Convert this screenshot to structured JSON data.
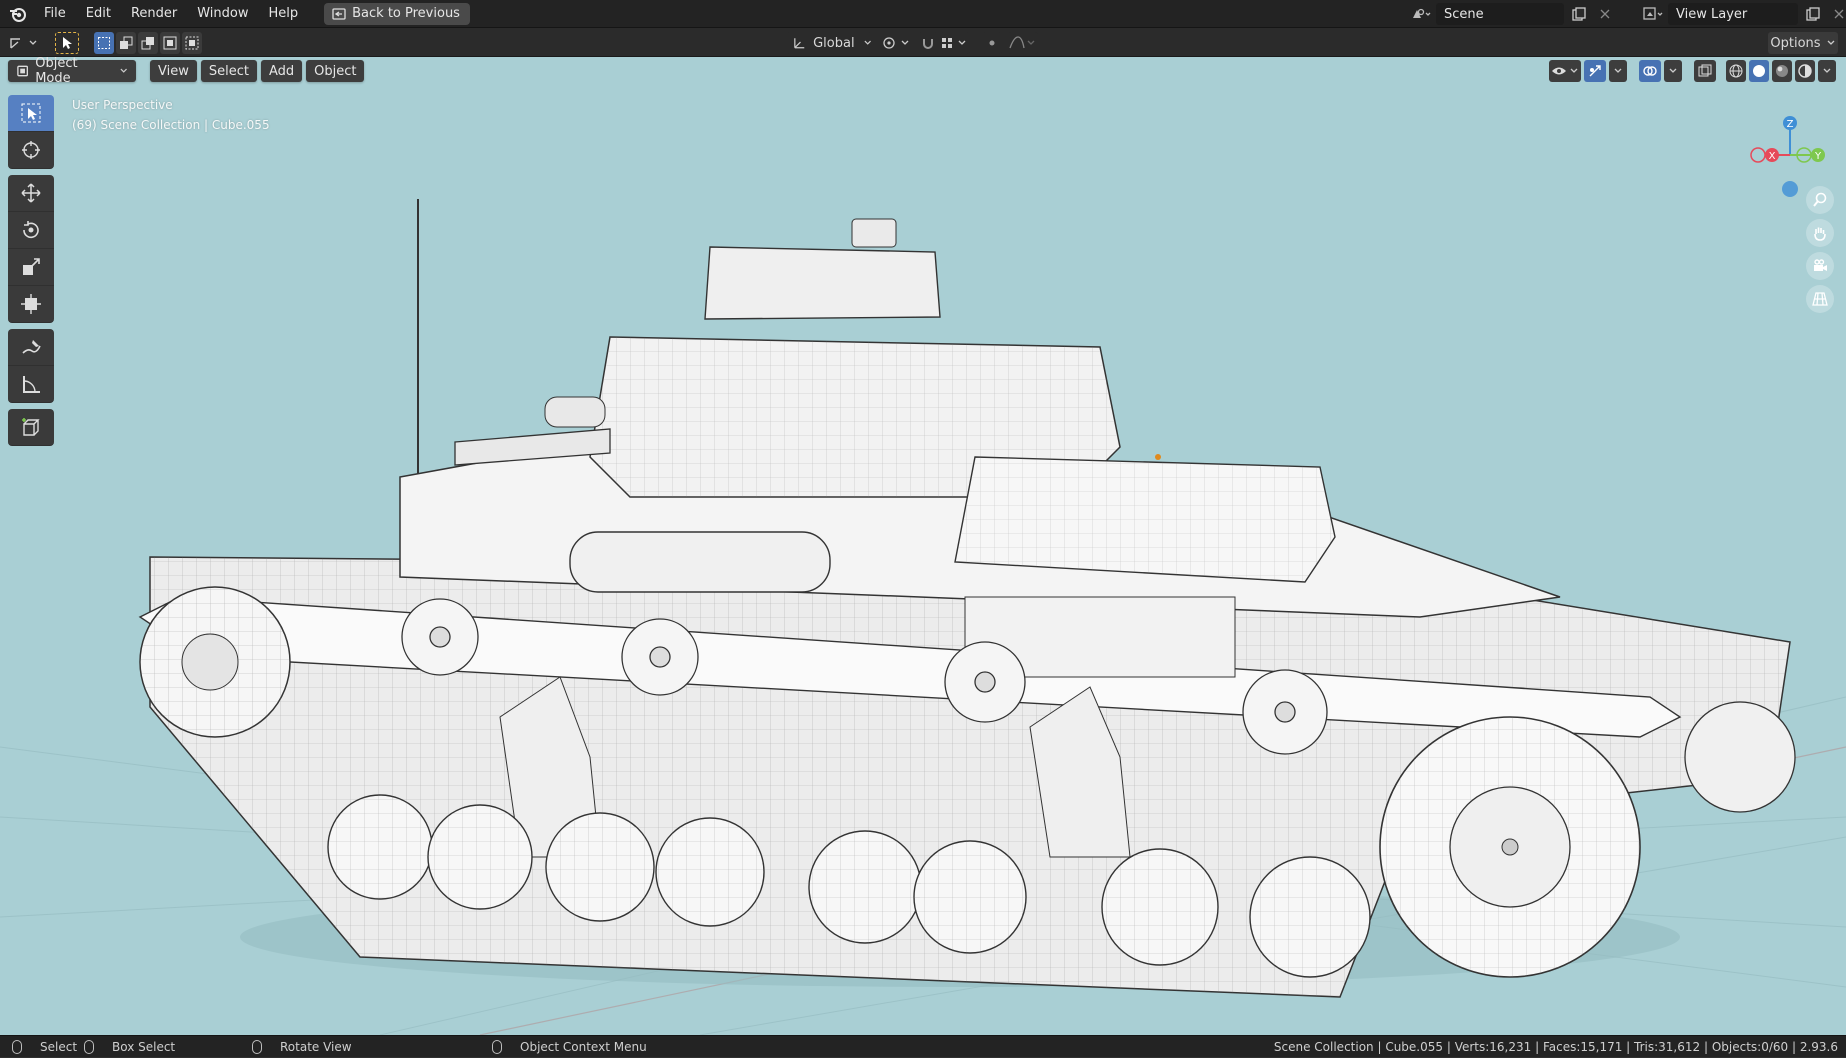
{
  "menu": {
    "items": [
      "File",
      "Edit",
      "Render",
      "Window",
      "Help"
    ],
    "back_button": "Back to Previous"
  },
  "scene": {
    "label": "Scene",
    "view_layer": "View Layer"
  },
  "toolbar": {
    "transform_orientation": "Global",
    "options_label": "Options"
  },
  "viewport_header": {
    "mode": "Object Mode",
    "menus": [
      "View",
      "Select",
      "Add",
      "Object"
    ]
  },
  "viewport_info": {
    "perspective": "User Perspective",
    "collection": "(69) Scene Collection | Cube.055"
  },
  "gizmo": {
    "x": "X",
    "y": "Y",
    "z": "Z"
  },
  "statusbar": {
    "select": "Select",
    "box_select": "Box Select",
    "rotate_view": "Rotate View",
    "context_menu": "Object Context Menu",
    "stats": "Scene Collection | Cube.055 | Verts:16,231 | Faces:15,171 | Tris:31,612 | Objects:0/60 | 2.93.6"
  },
  "colors": {
    "accent": "#4772b3",
    "viewport_bg": "#a9cfd4",
    "axis_x": "#e64a5a",
    "axis_y": "#7ec84e",
    "axis_z": "#3f8fd6"
  },
  "icons": [
    "blender-logo",
    "select-box-icon",
    "cursor-icon",
    "move-icon",
    "rotate-icon",
    "scale-icon",
    "transform-icon",
    "annotate-icon",
    "measure-icon",
    "add-cube-icon",
    "zoom-icon",
    "pan-icon",
    "camera-icon",
    "grid-icon"
  ]
}
